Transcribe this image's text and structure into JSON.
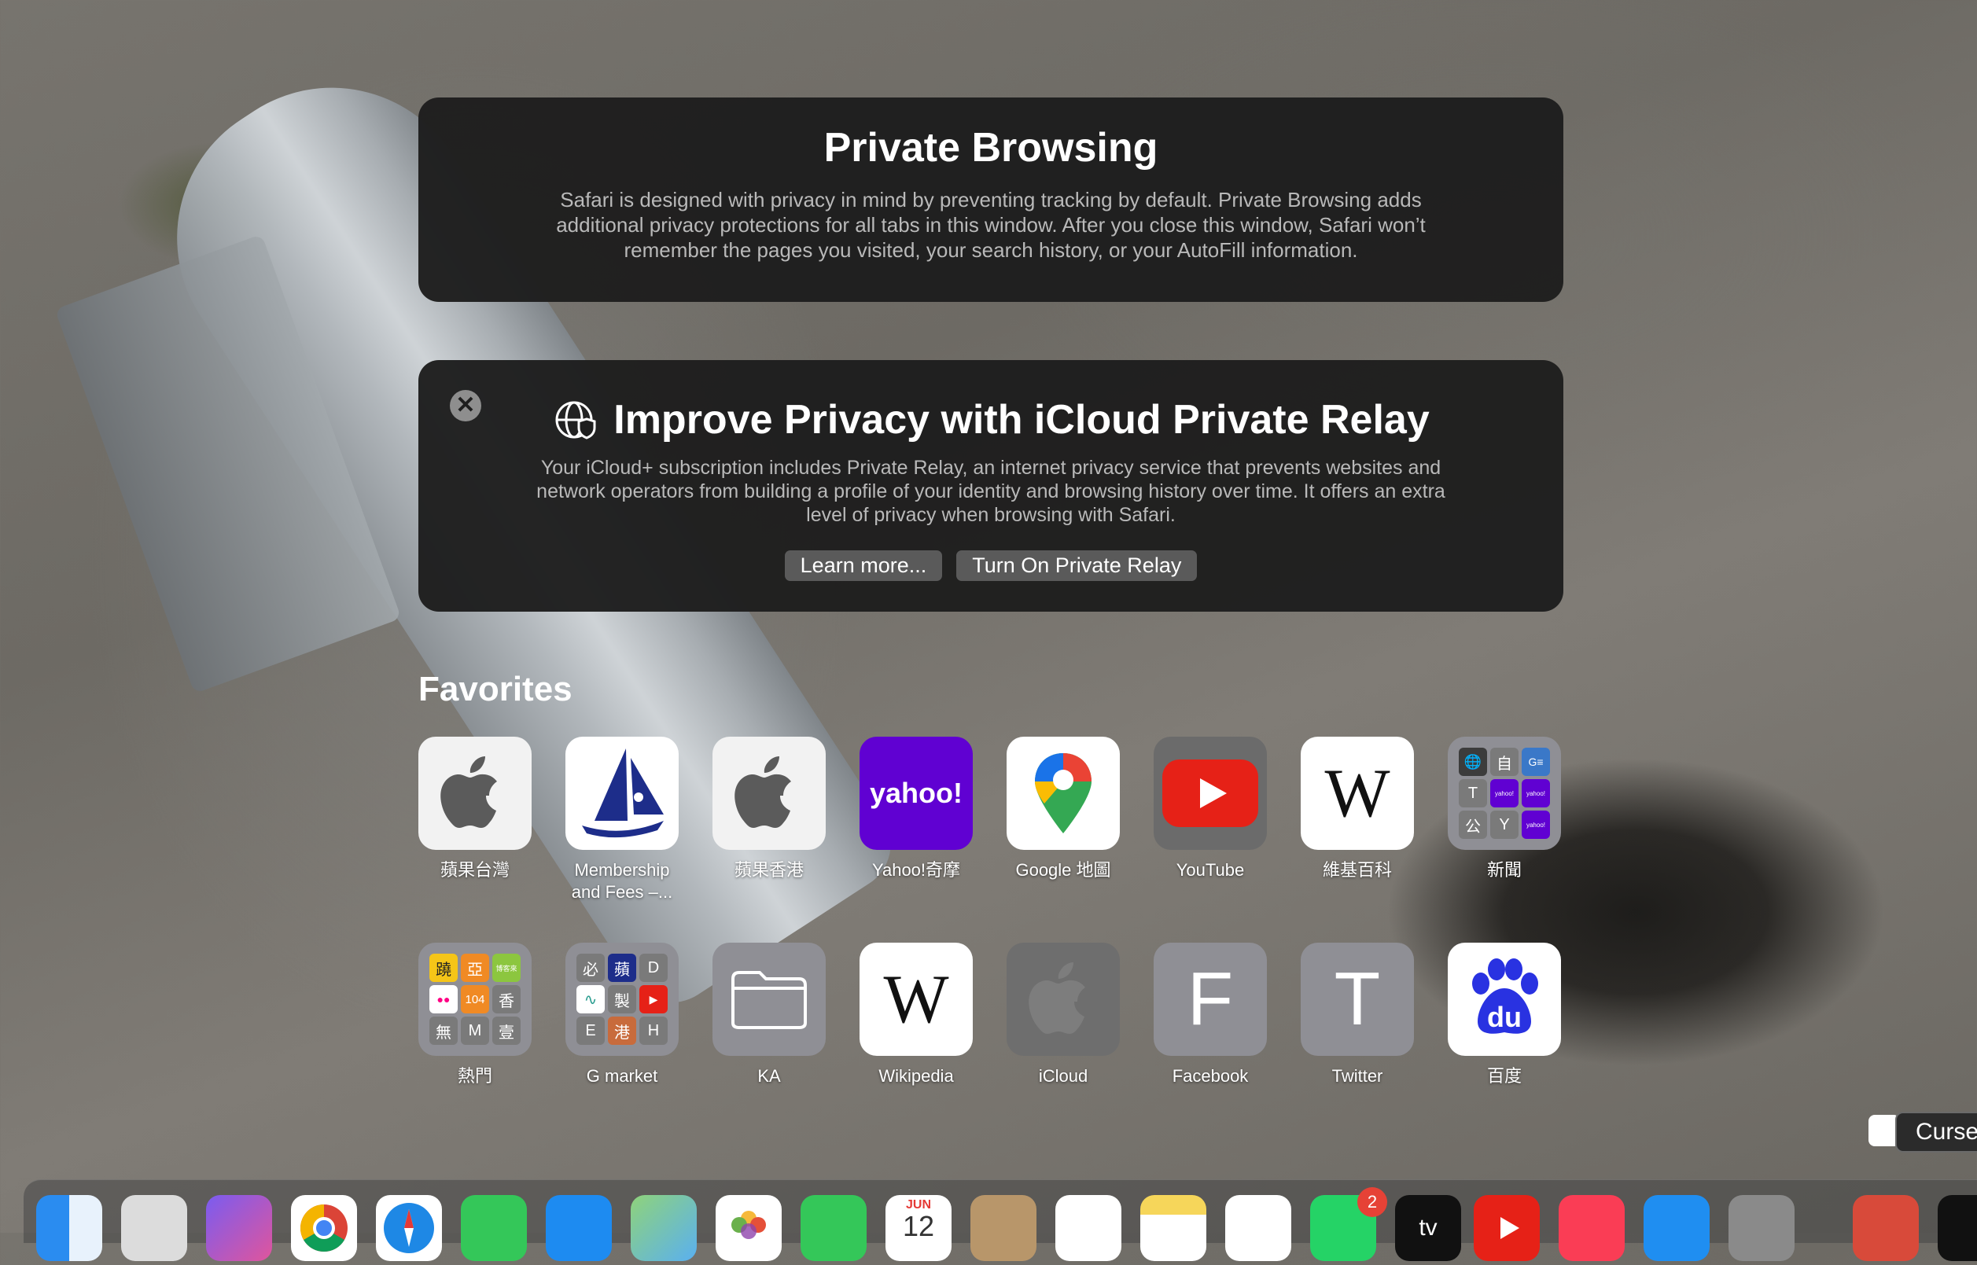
{
  "private_browsing": {
    "title": "Private Browsing",
    "description": "Safari is designed with privacy in mind by preventing tracking by default. Private Browsing adds additional privacy protections for all tabs in this window. After you close this window, Safari won’t remember the pages you visited, your search history, or your AutoFill information."
  },
  "relay": {
    "close_symbol": "✕",
    "title": "Improve Privacy with iCloud Private Relay",
    "description": "Your iCloud+ subscription includes Private Relay, an internet privacy service that prevents websites and network operators from building a profile of your identity and browsing history over time. It offers an extra level of privacy when browsing with Safari.",
    "learn_more": "Learn more...",
    "turn_on": "Turn On Private Relay"
  },
  "favorites": {
    "title": "Favorites",
    "row1": [
      {
        "label": "蘋果台灣",
        "icon": "apple-logo-icon"
      },
      {
        "label": "Membership",
        "label2": "and Fees –...",
        "icon": "sailboat-logo-icon"
      },
      {
        "label": "蘋果香港",
        "icon": "apple-logo-icon"
      },
      {
        "label": "Yahoo!奇摩",
        "icon": "yahoo-logo-icon",
        "text": "yahoo!"
      },
      {
        "label": "Google 地圖",
        "icon": "google-maps-icon"
      },
      {
        "label": "YouTube",
        "icon": "youtube-icon"
      },
      {
        "label": "維基百科",
        "icon": "wikipedia-icon",
        "text": "W"
      },
      {
        "label": "新聞",
        "icon": "folder-grid-icon"
      }
    ],
    "row2": [
      {
        "label": "熱門",
        "icon": "folder-grid-icon"
      },
      {
        "label": "G market",
        "icon": "folder-grid-icon"
      },
      {
        "label": "KA",
        "icon": "folder-icon"
      },
      {
        "label": "Wikipedia",
        "icon": "wikipedia-icon",
        "text": "W"
      },
      {
        "label": "iCloud",
        "icon": "apple-logo-icon"
      },
      {
        "label": "Facebook",
        "icon": "letter-icon",
        "text": "F"
      },
      {
        "label": "Twitter",
        "icon": "letter-icon",
        "text": "T"
      },
      {
        "label": "百度",
        "icon": "baidu-paw-icon",
        "text": "du"
      }
    ],
    "news_folder": [
      "🌐",
      "自",
      "G≡",
      "T",
      "yahoo!",
      "yahoo!",
      "公",
      "Y",
      "yahoo!"
    ],
    "hot_folder": [
      "蹺",
      "亞",
      "博客來",
      "●●",
      "104",
      "香",
      "無",
      "M",
      "壹"
    ],
    "gmarket_folder": [
      "必",
      "蘋",
      "D",
      "∿",
      "製",
      "▶",
      "E",
      "港",
      "H"
    ]
  },
  "dock": {
    "calendar_month": "JUN",
    "calendar_day": "12",
    "whatsapp_badge": "2",
    "tv_label": "tv"
  },
  "tooltip": {
    "text": "Curse"
  },
  "colors": {
    "card_bg": "#1e1e1e",
    "button_bg": "#5a5a5a",
    "yahoo_purple": "#6001d2",
    "youtube_red": "#e62117",
    "baidu_blue": "#2932e1"
  }
}
